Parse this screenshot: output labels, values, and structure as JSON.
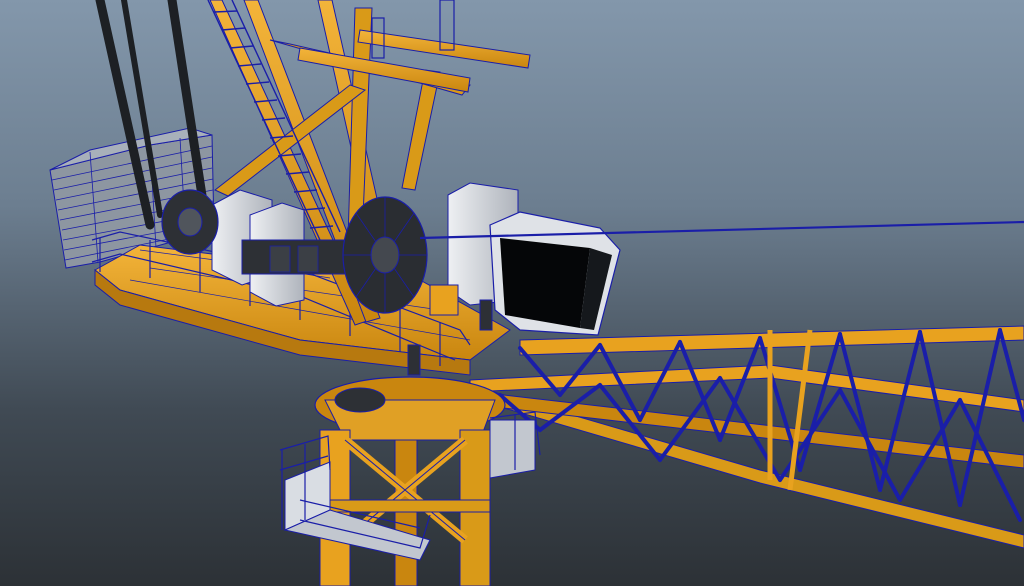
{
  "viewport": {
    "background_top": "#8397ab",
    "background_bottom": "#2c3136"
  },
  "scene": {
    "subject": "tower-crane-wireframe-render",
    "colors": {
      "steel": "#e8a21f",
      "steel_shade": "#b7790f",
      "wireframe": "#1a1ea8",
      "panel_white": "#d9dde3",
      "panel_shade": "#a9aeb6",
      "machinery_dark": "#2d3035",
      "cab_glass": "#050608",
      "counterweight": "#8d96a1"
    }
  }
}
